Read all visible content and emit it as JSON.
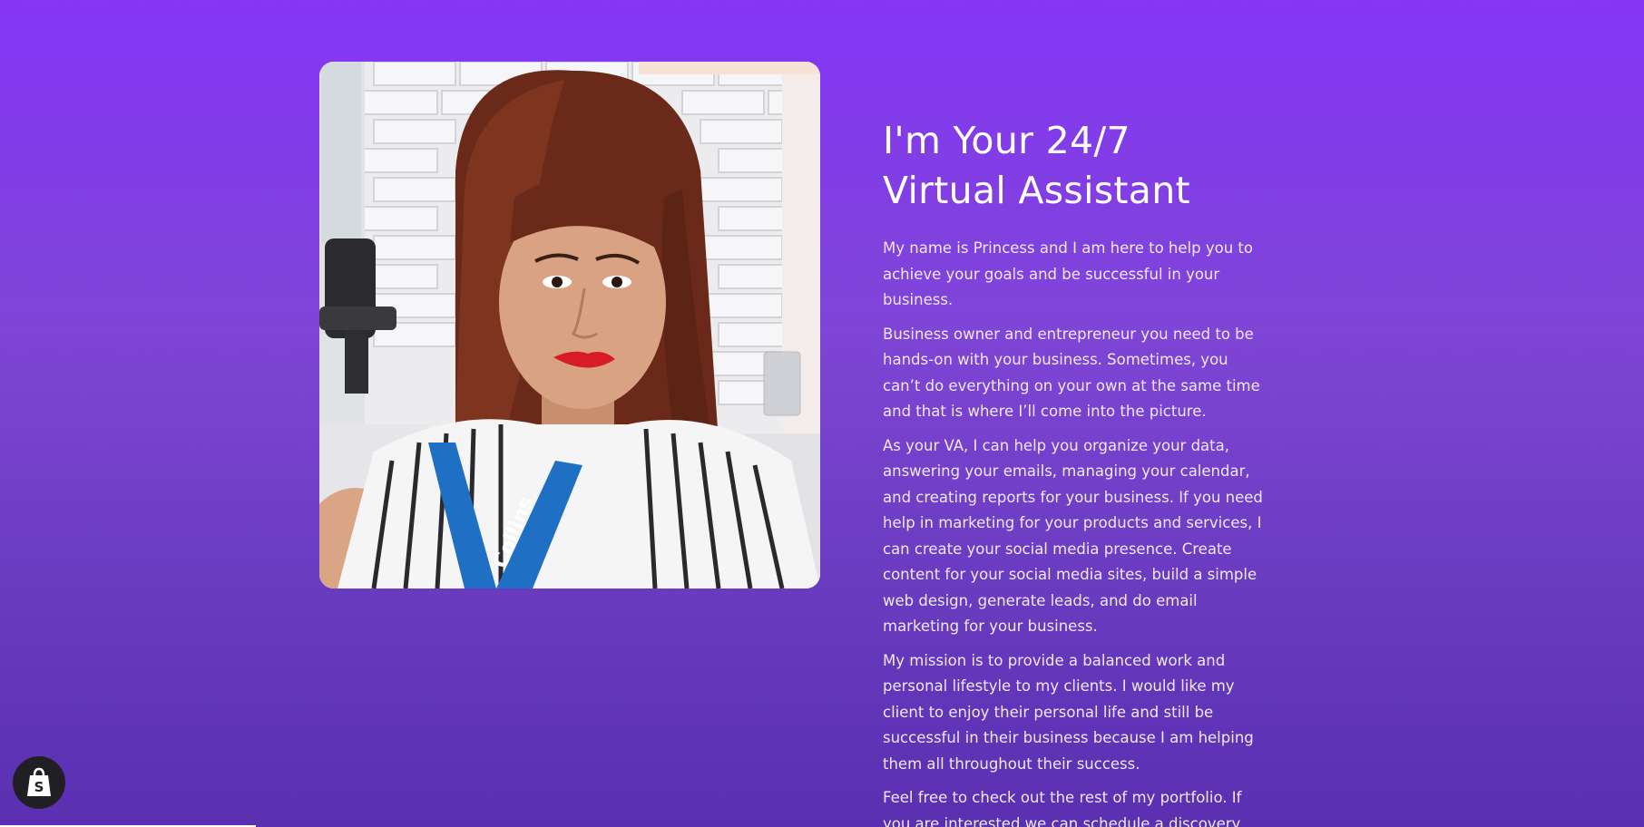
{
  "about": {
    "headline_line1": "I'm Your 24/7",
    "headline_line2": "Virtual Assistant",
    "paragraphs": [
      "My name is Princess and I am here to help you to achieve your goals and be successful in your business.",
      "Business owner and entrepreneur you need to be hands-on with your business. Sometimes, you can’t do everything on your own at the same time and that is where I’ll come into the picture.",
      "As your VA, I can help you organize your data, answering your emails, managing your calendar, and creating reports for your business. If you need help in marketing for your products and services, I can create your social media presence. Create content for your social media sites, build a simple web design, generate leads, and do email marketing for your business.",
      "My mission is to provide a balanced work and personal lifestyle to my clients. I would like my client to enjoy their personal life and still be successful in their business because I am helping them all throughout their success.",
      "Feel free to check out the rest of my portfolio. If you are interested we can schedule a discovery"
    ]
  },
  "photo": {
    "lanyard_text": "Collins"
  },
  "shop_badge": {
    "icon": "shopify-bag-icon",
    "glyph": "S"
  },
  "colors": {
    "gradient_top": "#8536f6",
    "gradient_bottom": "#5a2fb0",
    "text": "#ffffff"
  }
}
